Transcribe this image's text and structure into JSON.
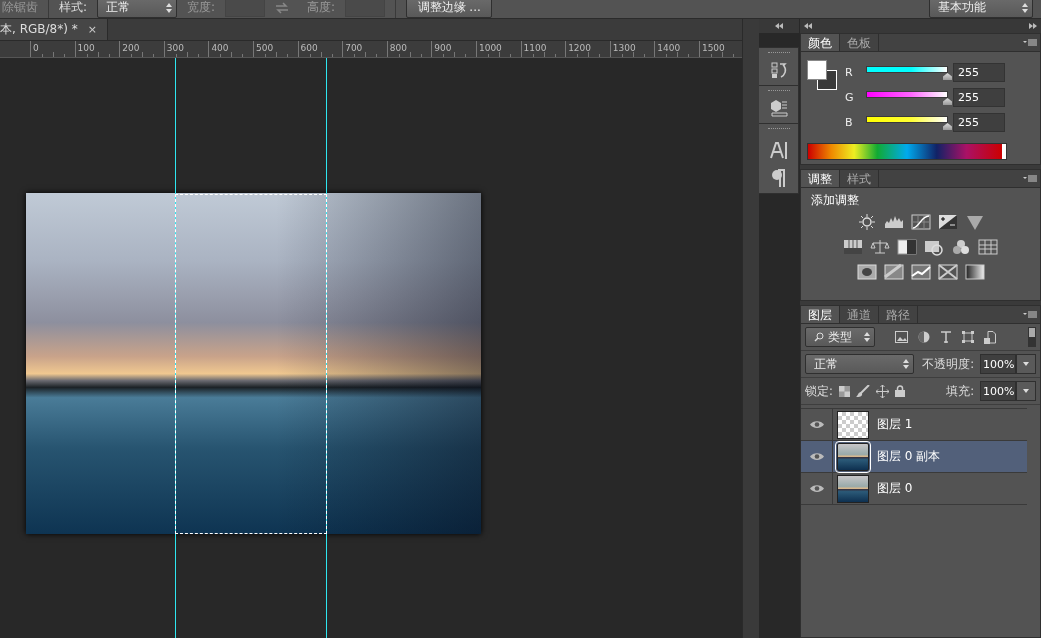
{
  "options_bar": {
    "antialias_label": "除锯齿",
    "style_label": "样式:",
    "style_value": "正常",
    "width_label": "宽度:",
    "height_label": "高度:",
    "refine_edge_button": "调整边缘 ...",
    "workspace": "基本功能"
  },
  "document": {
    "tab_title": "本, RGB/8*) *",
    "close": "×",
    "ruler_labels": [
      "0",
      "100",
      "200",
      "300",
      "400",
      "500",
      "600",
      "700",
      "800",
      "900",
      "1000",
      "1100",
      "1200",
      "1300",
      "1400",
      "1500"
    ]
  },
  "color_panel": {
    "tabs": [
      {
        "label": "颜色",
        "selected": true
      },
      {
        "label": "色板",
        "selected": false
      }
    ],
    "channels": [
      {
        "name": "R",
        "level": 1,
        "value": "255"
      },
      {
        "name": "G",
        "level": 1,
        "value": "255"
      },
      {
        "name": "B",
        "level": 1,
        "value": "255"
      }
    ]
  },
  "adjustments_panel": {
    "tabs": [
      {
        "label": "调整",
        "selected": true
      },
      {
        "label": "样式",
        "selected": false
      }
    ],
    "heading": "添加调整"
  },
  "layers_panel": {
    "tabs": [
      {
        "label": "图层",
        "selected": true
      },
      {
        "label": "通道",
        "selected": false
      },
      {
        "label": "路径",
        "selected": false
      }
    ],
    "filter_value": "类型",
    "blend_mode": "正常",
    "opacity_label": "不透明度:",
    "opacity_value": "100%",
    "lock_label": "锁定:",
    "fill_label": "填充:",
    "fill_value": "100%",
    "layers": [
      {
        "name": "图层 1",
        "visible": true,
        "selected": false,
        "kind": "partial"
      },
      {
        "name": "图层 0 副本",
        "visible": true,
        "selected": true,
        "kind": "photo"
      },
      {
        "name": "图层 0",
        "visible": true,
        "selected": false,
        "kind": "photo"
      }
    ]
  }
}
